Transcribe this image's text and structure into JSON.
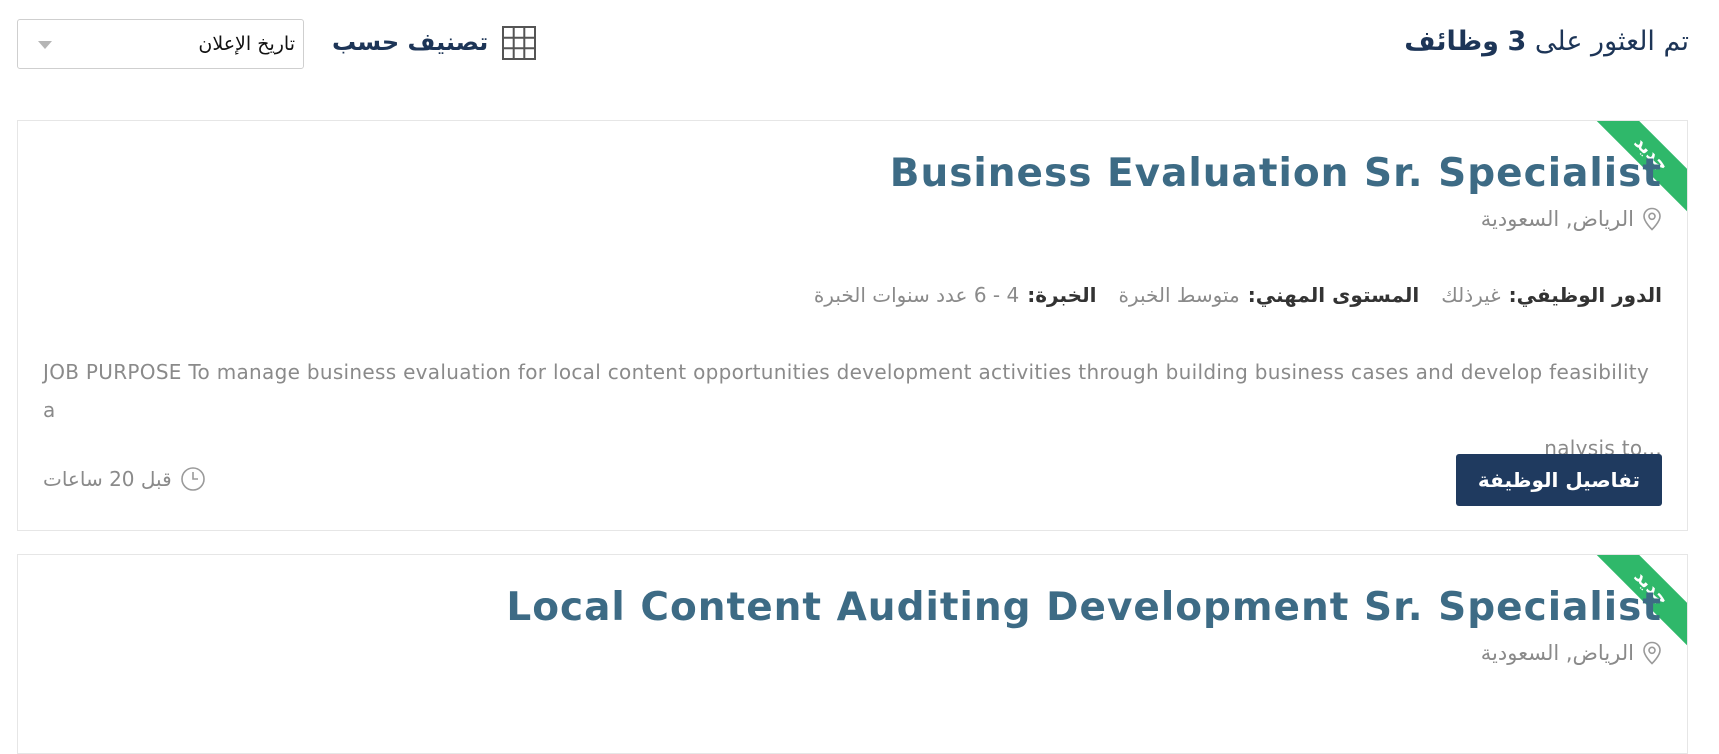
{
  "header": {
    "results_prefix": "تم العثور على",
    "results_count": "3",
    "results_suffix": "وظائف",
    "sort_label": "تصنيف حسب",
    "sort_selected": "تاريخ الإعلان",
    "grid_view_icon": "grid-icon"
  },
  "jobs": [
    {
      "badge": "جديد",
      "title": "Business Evaluation Sr. Specialist",
      "location": "الرياض, السعودية",
      "role_label": "الدور الوظيفي:",
      "role_value": "غيرذلك",
      "level_label": "المستوى المهني:",
      "level_value": "متوسط الخبرة",
      "experience_label": "الخبرة:",
      "experience_value": "4 - 6 عدد سنوات الخبرة",
      "description_line1": "JOB PURPOSE To manage business evaluation for local content opportunities development activities through building business cases and develop feasibility a",
      "description_line2": "nalysis to...",
      "details_button": "تفاصيل الوظيفة",
      "posted": "قبل 20 ساعات"
    },
    {
      "badge": "جديد",
      "title": "Local Content Auditing Development Sr. Specialist",
      "location": "الرياض, السعودية"
    }
  ],
  "colors": {
    "primary": "#1f3a5f",
    "title": "#3d6b85",
    "badge": "#2fb86a",
    "muted": "#8a8a8a"
  }
}
